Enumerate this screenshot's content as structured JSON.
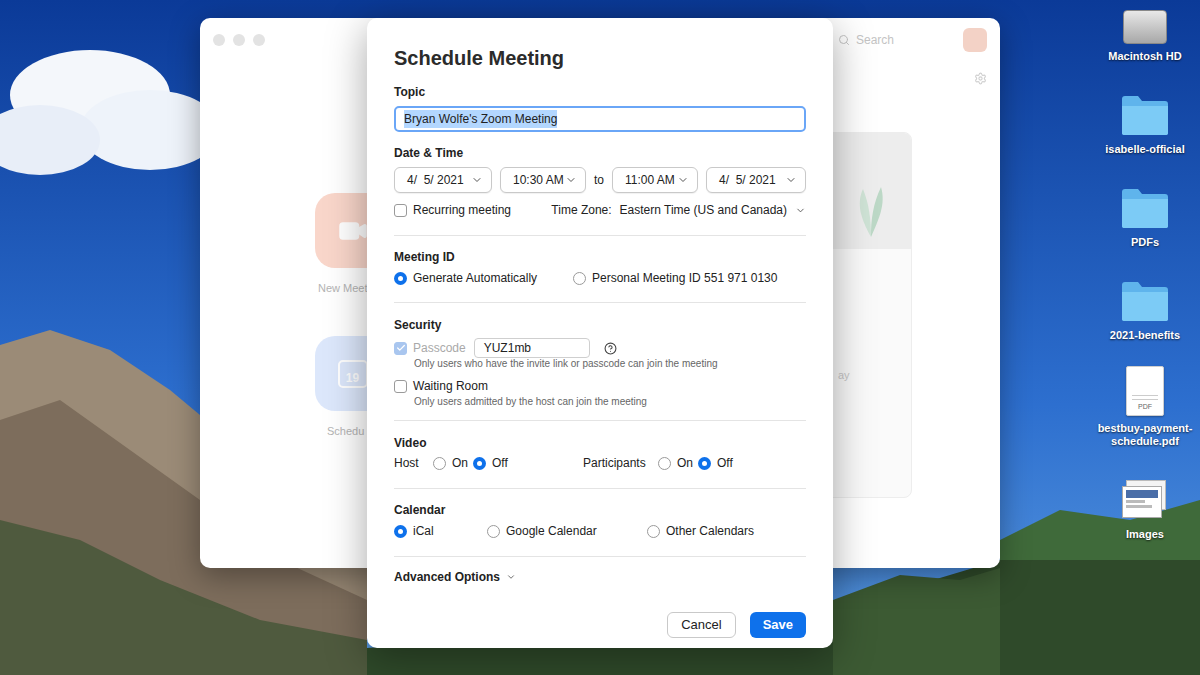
{
  "desktop": {
    "icons": [
      {
        "label": "Macintosh HD",
        "kind": "drive"
      },
      {
        "label": "isabelle-official",
        "kind": "folder"
      },
      {
        "label": "PDFs",
        "kind": "folder"
      },
      {
        "label": "2021-benefits",
        "kind": "folder"
      },
      {
        "label": "bestbuy-payment-schedule.pdf",
        "kind": "pdf",
        "badge": "PDF"
      },
      {
        "label": "Images",
        "kind": "images"
      }
    ]
  },
  "background_window": {
    "search": {
      "placeholder": "Search"
    },
    "tiles": [
      {
        "label": "New Meet",
        "kind": "video",
        "color": "#f9d6ca"
      },
      {
        "label": "Schedu",
        "kind": "calendar",
        "day": "19",
        "color": "#dce7fb"
      }
    ],
    "card_text": "ay"
  },
  "dialog": {
    "title": "Schedule Meeting",
    "topic": {
      "label": "Topic",
      "value": "Bryan Wolfe's Zoom Meeting",
      "selected": true
    },
    "date_time": {
      "label": "Date & Time",
      "start_date": "4/  5/ 2021",
      "start_time": "10:30 AM",
      "separator": "to",
      "end_time": "11:00 AM",
      "end_date": "4/  5/ 2021",
      "recurring": {
        "label": "Recurring meeting",
        "checked": false
      },
      "time_zone": {
        "label": "Time Zone:",
        "value": "Eastern Time (US and Canada)"
      }
    },
    "meeting_id": {
      "label": "Meeting ID",
      "options": [
        {
          "label": "Generate Automatically",
          "selected": true
        },
        {
          "label": "Personal Meeting ID 551 971 0130",
          "selected": false
        }
      ]
    },
    "security": {
      "label": "Security",
      "options": [
        {
          "label": "Passcode",
          "checked": true,
          "disabled": true,
          "value": "YUZ1mb",
          "hint": "Only users who have the invite link or passcode can join the meeting"
        },
        {
          "label": "Waiting Room",
          "checked": false,
          "disabled": false,
          "hint": "Only users admitted by the host can join the meeting"
        }
      ]
    },
    "video": {
      "label": "Video",
      "groups": [
        {
          "label": "Host",
          "options": [
            {
              "label": "On",
              "selected": false
            },
            {
              "label": "Off",
              "selected": true
            }
          ]
        },
        {
          "label": "Participants",
          "options": [
            {
              "label": "On",
              "selected": false
            },
            {
              "label": "Off",
              "selected": true
            }
          ]
        }
      ]
    },
    "calendar": {
      "label": "Calendar",
      "options": [
        {
          "label": "iCal",
          "selected": true
        },
        {
          "label": "Google Calendar",
          "selected": false
        },
        {
          "label": "Other Calendars",
          "selected": false
        }
      ]
    },
    "advanced": {
      "label": "Advanced Options",
      "expanded": false
    },
    "buttons": [
      {
        "label": "Cancel",
        "primary": false
      },
      {
        "label": "Save",
        "primary": true
      }
    ]
  }
}
